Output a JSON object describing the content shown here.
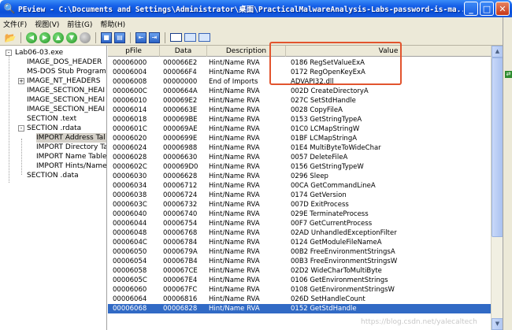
{
  "window": {
    "title": "PEview - C:\\Documents and Settings\\Administrator\\桌面\\PracticalMalwareAnalysis-Labs-password-is-ma...",
    "buttons": {
      "minimize": "_",
      "maximize": "□",
      "close": "✕"
    }
  },
  "menu": [
    {
      "label": "文件(F)"
    },
    {
      "label": "视图(V)"
    },
    {
      "label": "前往(G)"
    },
    {
      "label": "帮助(H)"
    }
  ],
  "toolbar": {
    "icons": [
      "open-folder-icon",
      "back-icon",
      "forward-icon",
      "up-icon",
      "down-icon",
      "stop-icon",
      "save-icon",
      "copy-icon",
      "import-icon",
      "export-icon",
      "byte-view-icon",
      "word-view-icon",
      "dword-view-icon"
    ]
  },
  "tree": [
    {
      "label": "Lab06-03.exe",
      "level": 0,
      "expander": "-",
      "selected": false
    },
    {
      "label": "IMAGE_DOS_HEADER",
      "level": 1,
      "expander": "",
      "selected": false
    },
    {
      "label": "MS-DOS Stub Program",
      "level": 1,
      "expander": "",
      "selected": false
    },
    {
      "label": "IMAGE_NT_HEADERS",
      "level": 1,
      "expander": "+",
      "selected": false
    },
    {
      "label": "IMAGE_SECTION_HEAI",
      "level": 1,
      "expander": "",
      "selected": false
    },
    {
      "label": "IMAGE_SECTION_HEAI",
      "level": 1,
      "expander": "",
      "selected": false
    },
    {
      "label": "IMAGE_SECTION_HEAI",
      "level": 1,
      "expander": "",
      "selected": false
    },
    {
      "label": "SECTION .text",
      "level": 1,
      "expander": "",
      "selected": false
    },
    {
      "label": "SECTION .rdata",
      "level": 1,
      "expander": "-",
      "selected": false
    },
    {
      "label": "IMPORT Address Tal",
      "level": 2,
      "expander": "",
      "selected": true
    },
    {
      "label": "IMPORT Directory Ta",
      "level": 2,
      "expander": "",
      "selected": false
    },
    {
      "label": "IMPORT Name Table",
      "level": 2,
      "expander": "",
      "selected": false
    },
    {
      "label": "IMPORT Hints/Name",
      "level": 2,
      "expander": "",
      "selected": false
    },
    {
      "label": "SECTION .data",
      "level": 1,
      "expander": "",
      "selected": false
    }
  ],
  "grid": {
    "columns": [
      "pFile",
      "Data",
      "Description",
      "Value"
    ],
    "rows": [
      {
        "pfile": "00006000",
        "data": "000066E2",
        "desc": "Hint/Name RVA",
        "value": "0186  RegSetValueExA"
      },
      {
        "pfile": "00006004",
        "data": "000066F4",
        "desc": "Hint/Name RVA",
        "value": "0172  RegOpenKeyExA"
      },
      {
        "pfile": "00006008",
        "data": "00000000",
        "desc": "End of Imports",
        "value": "ADVAPI32.dll"
      },
      {
        "pfile": "0000600C",
        "data": "0000664A",
        "desc": "Hint/Name RVA",
        "value": "002D  CreateDirectoryA"
      },
      {
        "pfile": "00006010",
        "data": "000069E2",
        "desc": "Hint/Name RVA",
        "value": "027C  SetStdHandle"
      },
      {
        "pfile": "00006014",
        "data": "0000663E",
        "desc": "Hint/Name RVA",
        "value": "0028  CopyFileA"
      },
      {
        "pfile": "00006018",
        "data": "000069BE",
        "desc": "Hint/Name RVA",
        "value": "0153  GetStringTypeA"
      },
      {
        "pfile": "0000601C",
        "data": "000069AE",
        "desc": "Hint/Name RVA",
        "value": "01C0  LCMapStringW"
      },
      {
        "pfile": "00006020",
        "data": "0000699E",
        "desc": "Hint/Name RVA",
        "value": "01BF  LCMapStringA"
      },
      {
        "pfile": "00006024",
        "data": "00006988",
        "desc": "Hint/Name RVA",
        "value": "01E4  MultiByteToWideChar"
      },
      {
        "pfile": "00006028",
        "data": "00006630",
        "desc": "Hint/Name RVA",
        "value": "0057  DeleteFileA"
      },
      {
        "pfile": "0000602C",
        "data": "000069D0",
        "desc": "Hint/Name RVA",
        "value": "0156  GetStringTypeW"
      },
      {
        "pfile": "00006030",
        "data": "00006628",
        "desc": "Hint/Name RVA",
        "value": "0296  Sleep"
      },
      {
        "pfile": "00006034",
        "data": "00006712",
        "desc": "Hint/Name RVA",
        "value": "00CA  GetCommandLineA"
      },
      {
        "pfile": "00006038",
        "data": "00006724",
        "desc": "Hint/Name RVA",
        "value": "0174  GetVersion"
      },
      {
        "pfile": "0000603C",
        "data": "00006732",
        "desc": "Hint/Name RVA",
        "value": "007D  ExitProcess"
      },
      {
        "pfile": "00006040",
        "data": "00006740",
        "desc": "Hint/Name RVA",
        "value": "029E  TerminateProcess"
      },
      {
        "pfile": "00006044",
        "data": "00006754",
        "desc": "Hint/Name RVA",
        "value": "00F7  GetCurrentProcess"
      },
      {
        "pfile": "00006048",
        "data": "00006768",
        "desc": "Hint/Name RVA",
        "value": "02AD  UnhandledExceptionFilter"
      },
      {
        "pfile": "0000604C",
        "data": "00006784",
        "desc": "Hint/Name RVA",
        "value": "0124  GetModuleFileNameA"
      },
      {
        "pfile": "00006050",
        "data": "0000679A",
        "desc": "Hint/Name RVA",
        "value": "00B2  FreeEnvironmentStringsA"
      },
      {
        "pfile": "00006054",
        "data": "000067B4",
        "desc": "Hint/Name RVA",
        "value": "00B3  FreeEnvironmentStringsW"
      },
      {
        "pfile": "00006058",
        "data": "000067CE",
        "desc": "Hint/Name RVA",
        "value": "02D2  WideCharToMultiByte"
      },
      {
        "pfile": "0000605C",
        "data": "000067E4",
        "desc": "Hint/Name RVA",
        "value": "0106  GetEnvironmentStrings"
      },
      {
        "pfile": "00006060",
        "data": "000067FC",
        "desc": "Hint/Name RVA",
        "value": "0108  GetEnvironmentStringsW"
      },
      {
        "pfile": "00006064",
        "data": "00006816",
        "desc": "Hint/Name RVA",
        "value": "026D  SetHandleCount"
      },
      {
        "pfile": "00006068",
        "data": "00006828",
        "desc": "Hint/Name RVA",
        "value": "0152  GetStdHandle",
        "selected": true
      }
    ]
  },
  "watermark": "https://blog.csdn.net/yalecaltech",
  "colors": {
    "titlebar": "#0a4fd8",
    "selection": "#316ac5",
    "highlight_box": "#e2542e",
    "chrome": "#ece9d8"
  }
}
